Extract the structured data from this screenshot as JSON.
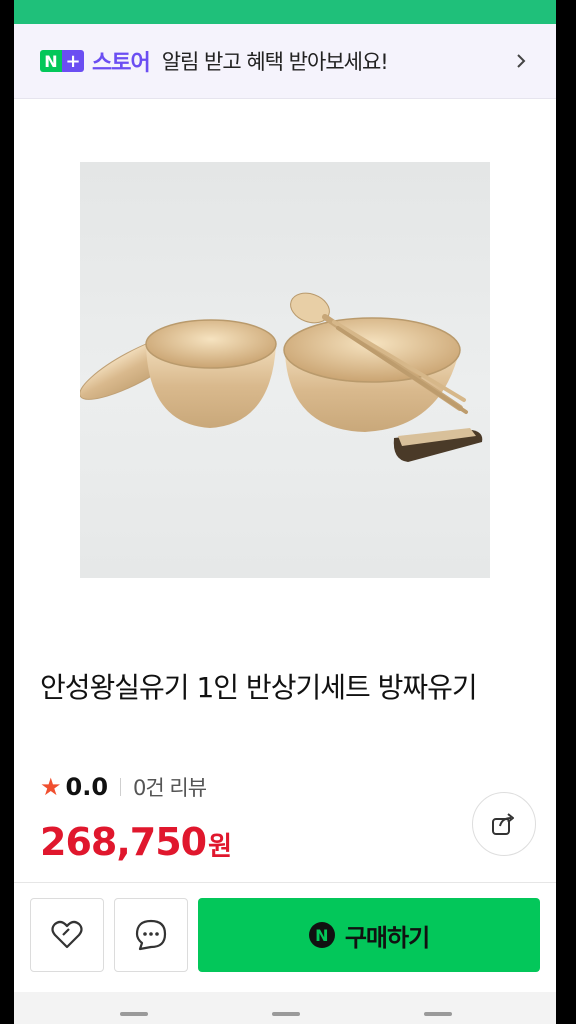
{
  "banner": {
    "logo_n": "N",
    "logo_plus": "+",
    "brand": "스토어",
    "text": "알림 받고 혜택 받아보세요!",
    "chevron_icon": "chevron-right-icon"
  },
  "product": {
    "image_icon": "brassware-product-photo",
    "title": "안성왕실유기 1인 반상기세트 방짜유기",
    "rating": {
      "star_icon": "★",
      "value": "0.0",
      "review_count": "0건 리뷰"
    },
    "price": {
      "amount": "268,750",
      "unit": "원"
    },
    "share_icon": "share-icon"
  },
  "actions": {
    "wish_icon": "heart-icon",
    "talk_icon": "chat-bubble-icon",
    "buy_badge": "N",
    "buy_label": "구매하기"
  },
  "colors": {
    "accent_green": "#03c75a",
    "brand_purple": "#6b4ef2",
    "price_red": "#e0172d",
    "star_orange": "#f04f2f"
  }
}
